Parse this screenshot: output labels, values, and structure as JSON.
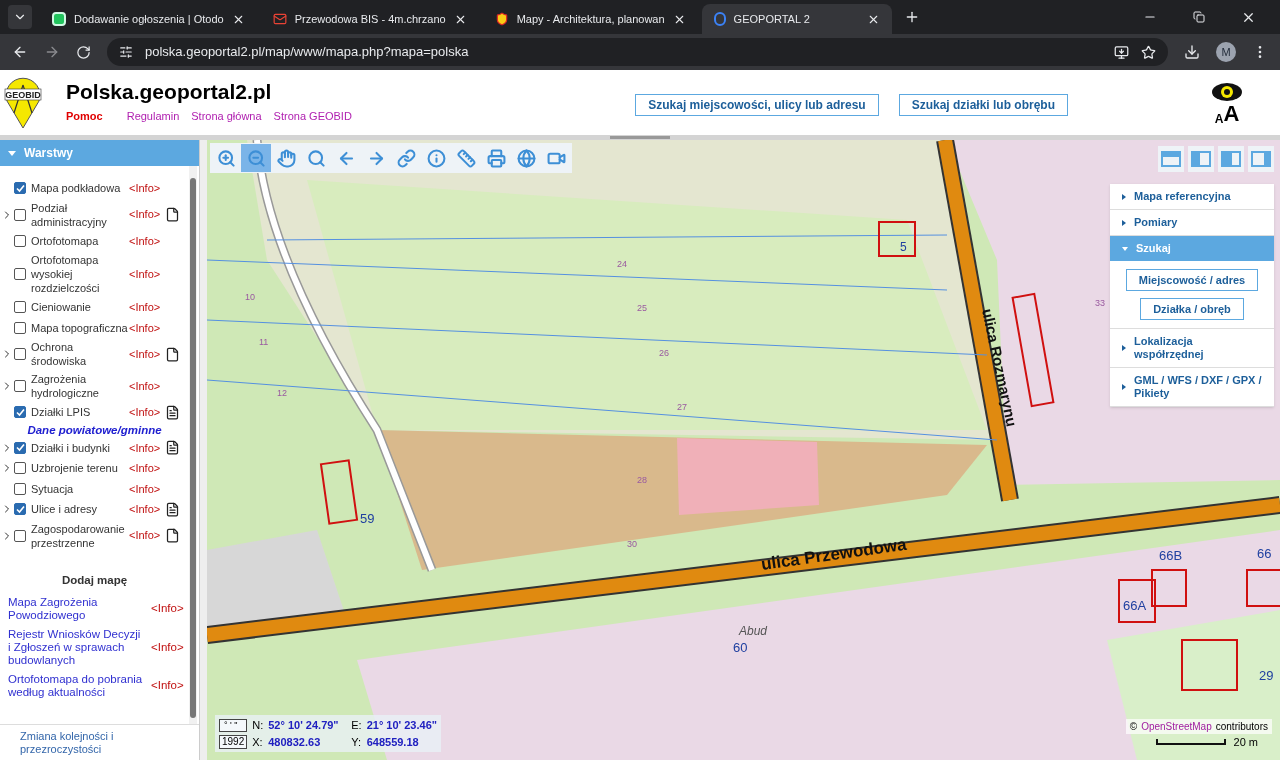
{
  "browser": {
    "tabs": [
      {
        "title": "Dodawanie ogłoszenia | Otodo",
        "selected": false,
        "kind": "square"
      },
      {
        "title": "Przewodowa BIS - 4m.chrzano",
        "selected": false,
        "kind": "mail"
      },
      {
        "title": "Mapy - Architektura, planowan",
        "selected": false,
        "kind": "crest"
      },
      {
        "title": "GEOPORTAL 2",
        "selected": true,
        "kind": "g"
      }
    ],
    "address": "polska.geoportal2.pl/map/www/mapa.php?mapa=polska",
    "profile": "M"
  },
  "header": {
    "logo": "GEOBID",
    "title": "Polska.geoportal2.pl",
    "links": [
      {
        "label": "Pomoc",
        "kind": "primary"
      },
      {
        "label": "Regulamin",
        "kind": "secondary"
      },
      {
        "label": "Strona główna",
        "kind": "secondary"
      },
      {
        "label": "Strona GEOBID",
        "kind": "secondary"
      }
    ],
    "search_buttons": [
      "Szukaj miejscowości, ulicy lub adresu",
      "Szukaj działki lub obrębu"
    ],
    "font_size_label": {
      "small": "A",
      "large": "A"
    }
  },
  "sidebar": {
    "title": "Warstwy",
    "expanded": true,
    "layers": [
      {
        "kind": "layer",
        "label": "Mapa podkładowa",
        "checked": true,
        "expandable": false,
        "info": "<Info>"
      },
      {
        "kind": "layer",
        "label": "Podział administracyjny",
        "checked": false,
        "expandable": true,
        "info": "<Info>",
        "document": {
          "kind": "page"
        }
      },
      {
        "kind": "layer",
        "label": "Ortofotomapa",
        "checked": false,
        "expandable": false,
        "info": "<Info>"
      },
      {
        "kind": "layer",
        "label": "Ortofotomapa wysokiej rozdzielczości",
        "checked": false,
        "expandable": false,
        "info": "<Info>"
      },
      {
        "kind": "layer",
        "label": "Cieniowanie",
        "checked": false,
        "expandable": false,
        "info": "<Info>"
      },
      {
        "kind": "layer",
        "label": "Mapa topograficzna",
        "checked": false,
        "expandable": false,
        "info": "<Info>"
      },
      {
        "kind": "layer",
        "label": "Ochrona środowiska",
        "checked": false,
        "expandable": true,
        "info": "<Info>",
        "document": {
          "kind": "page"
        }
      },
      {
        "kind": "layer",
        "label": "Zagrożenia hydrologiczne",
        "checked": false,
        "expandable": true,
        "info": "<Info>"
      },
      {
        "kind": "layer",
        "label": "Działki LPIS",
        "checked": true,
        "expandable": false,
        "info": "<Info>",
        "document": {
          "kind": "info"
        }
      },
      {
        "kind": "section",
        "label": "Dane powiatowe/gminne"
      },
      {
        "kind": "layer",
        "label": "Działki i budynki",
        "checked": true,
        "expandable": true,
        "info": "<Info>",
        "document": {
          "kind": "info"
        }
      },
      {
        "kind": "layer",
        "label": "Uzbrojenie terenu",
        "checked": false,
        "expandable": true,
        "info": "<Info>"
      },
      {
        "kind": "layer",
        "label": "Sytuacja",
        "checked": false,
        "expandable": false,
        "info": "<Info>"
      },
      {
        "kind": "layer",
        "label": "Ulice i adresy",
        "checked": true,
        "expandable": true,
        "info": "<Info>",
        "document": {
          "kind": "info"
        }
      },
      {
        "kind": "layer",
        "label": "Zagospodarowanie przestrzenne",
        "checked": false,
        "expandable": true,
        "info": "<Info>",
        "document": {
          "kind": "page"
        }
      }
    ],
    "add_map": {
      "title": "Dodaj mapę",
      "items": [
        {
          "label": "Mapa Zagrożenia Powodziowego",
          "info": "<Info>"
        },
        {
          "label": "Rejestr Wniosków Decyzji i Zgłoszeń w sprawach budowlanych",
          "info": "<Info>"
        },
        {
          "label": "Ortofotomapa do pobrania według aktualności",
          "info": "<Info>"
        }
      ]
    },
    "footer": "Zmiana kolejności i przezroczystości"
  },
  "toolbar": [
    {
      "kind": "zoom_in",
      "selected": false
    },
    {
      "kind": "zoom_out",
      "selected": true
    },
    {
      "kind": "pan",
      "selected": false
    },
    {
      "kind": "zoom_box",
      "selected": false
    },
    {
      "kind": "back",
      "selected": false
    },
    {
      "kind": "forward",
      "selected": false
    },
    {
      "kind": "link",
      "selected": false
    },
    {
      "kind": "info",
      "selected": false
    },
    {
      "kind": "measure",
      "selected": false
    },
    {
      "kind": "print",
      "selected": false
    },
    {
      "kind": "globe",
      "selected": false
    },
    {
      "kind": "video",
      "selected": false
    }
  ],
  "right_panel": {
    "view_buttons": [
      {
        "kind": "top"
      },
      {
        "kind": "left"
      },
      {
        "kind": "arrow"
      },
      {
        "kind": "right"
      }
    ],
    "sections": [
      {
        "label": "Mapa referencyjna",
        "expanded": false
      },
      {
        "label": "Pomiary",
        "expanded": false
      },
      {
        "label": "Szukaj",
        "expanded": true,
        "buttons": [
          "Miejscowość / adres",
          "Działka / obręb"
        ]
      },
      {
        "label": "Lokalizacja współrzędnej",
        "expanded": false
      },
      {
        "label": "GML / WFS / DXF / GPX / Pikiety",
        "expanded": false
      }
    ]
  },
  "map": {
    "labels": [
      {
        "kind": "street",
        "text": "ulica Przewodowa"
      },
      {
        "kind": "street",
        "text": "ulica Rozmarynu"
      },
      {
        "kind": "house",
        "text": "59"
      },
      {
        "kind": "house",
        "text": "60"
      },
      {
        "kind": "house",
        "text": "66A"
      },
      {
        "kind": "house",
        "text": "66B"
      },
      {
        "kind": "house",
        "text": "66"
      },
      {
        "kind": "house",
        "text": "29"
      },
      {
        "kind": "house",
        "text": "5"
      },
      {
        "kind": "place",
        "text": "Abud"
      },
      {
        "kind": "parcel",
        "text": "24"
      },
      {
        "kind": "parcel",
        "text": "25"
      },
      {
        "kind": "parcel",
        "text": "26"
      },
      {
        "kind": "parcel",
        "text": "27"
      },
      {
        "kind": "parcel",
        "text": "28"
      },
      {
        "kind": "parcel",
        "text": "30"
      },
      {
        "kind": "parcel",
        "text": "10"
      },
      {
        "kind": "parcel",
        "text": "11"
      },
      {
        "kind": "parcel",
        "text": "12"
      },
      {
        "kind": "parcel",
        "text": "33"
      }
    ],
    "coords": {
      "format_dms": "° ' \"",
      "format_1992": "1992",
      "n_label": "N:",
      "n_value": "52° 10' 24.79\"",
      "e_label": "E:",
      "e_value": "21° 10' 23.46\"",
      "x_label": "X:",
      "x_value": "480832.63",
      "y_label": "Y:",
      "y_value": "648559.18"
    },
    "attribution": {
      "prefix": "©",
      "link": "OpenStreetMap",
      "suffix": "contributors"
    },
    "scale": "20 m"
  }
}
